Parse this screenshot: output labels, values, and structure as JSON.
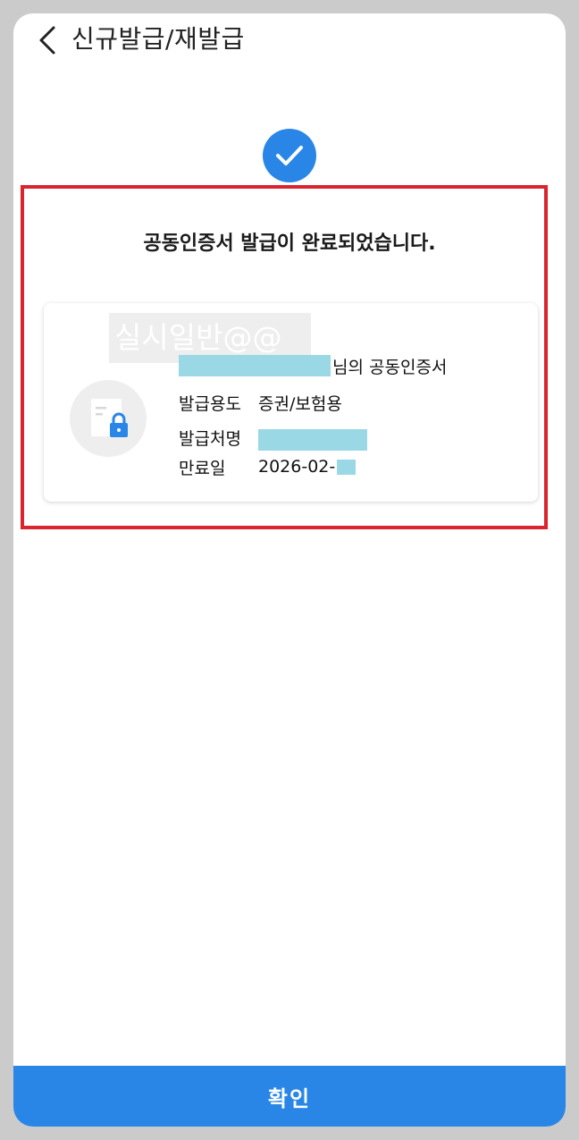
{
  "header": {
    "back_icon": "chevron-left-icon",
    "title": "신규발급/재발급"
  },
  "status": {
    "icon": "check-circle-icon",
    "accent": "#2a86e6",
    "message": "공동인증서 발급이 완료되었습니다."
  },
  "certificate": {
    "watermark_text": "실시일반@@",
    "owner_suffix": "님의 공동인증서",
    "icon": "certificate-lock-icon",
    "fields": [
      {
        "label": "발급용도",
        "value": "증권/보험용"
      },
      {
        "label": "발급처명",
        "value": ""
      },
      {
        "label": "만료일",
        "value": "2026-02-"
      }
    ]
  },
  "footer": {
    "confirm_label": "확인"
  },
  "colors": {
    "highlight_border": "#d9252e",
    "redaction": "#9ad8e6",
    "button": "#2a86e6"
  }
}
